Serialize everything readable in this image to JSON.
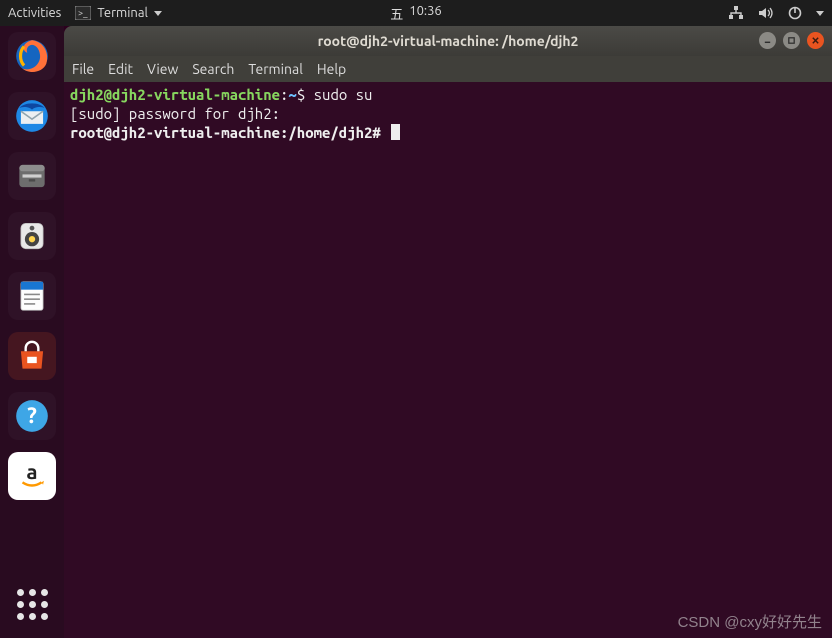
{
  "topbar": {
    "activities": "Activities",
    "app_indicator": "Terminal",
    "clock_day": "五",
    "clock_time": "10:36"
  },
  "dock": {
    "tooltip": "Ubuntu Software"
  },
  "window": {
    "title": "root@djh2-virtual-machine: /home/djh2",
    "menubar": {
      "file": "File",
      "edit": "Edit",
      "view": "View",
      "search": "Search",
      "terminal": "Terminal",
      "help": "Help"
    }
  },
  "terminal": {
    "line1": {
      "user_host": "djh2@djh2-virtual-machine",
      "colon": ":",
      "path": "~",
      "sep": "$ ",
      "cmd": "sudo su"
    },
    "line2": "[sudo] password for djh2:",
    "line3": {
      "prompt": "root@djh2-virtual-machine:/home/djh2# "
    }
  },
  "watermark": "CSDN @cxy好好先生"
}
